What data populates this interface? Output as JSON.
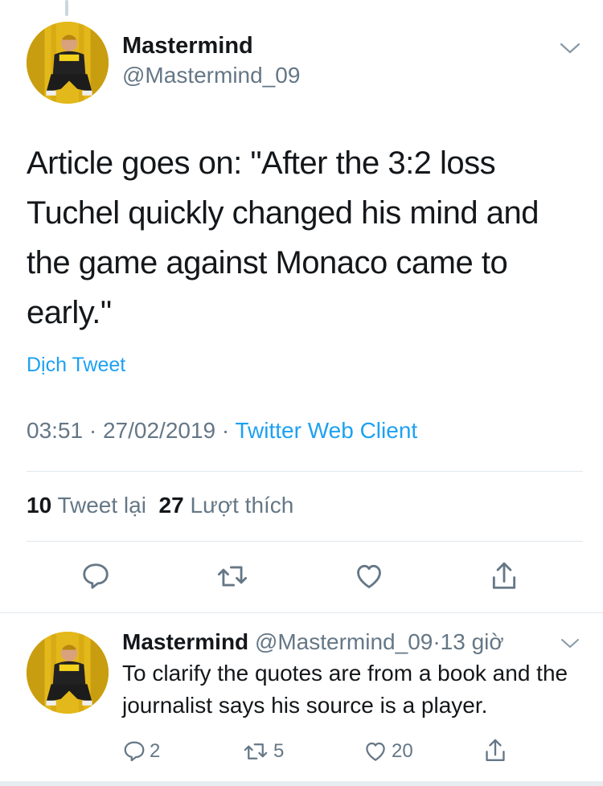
{
  "main_tweet": {
    "display_name": "Mastermind",
    "handle": "@Mastermind_09",
    "text": "Article goes on: \"After the 3:2 loss Tuchel quickly changed his mind and the game against Monaco came to early.\"",
    "translate_label": "Dịch Tweet",
    "time": "03:51",
    "date": "27/02/2019",
    "separator": "·",
    "client": "Twitter Web Client",
    "retweet_count": "10",
    "retweet_label": "Tweet lại",
    "like_count": "27",
    "like_label": "Lượt thích"
  },
  "reply_tweet": {
    "display_name": "Mastermind",
    "handle": "@Mastermind_09",
    "separator": "·",
    "age": "13 giờ",
    "text": "To clarify the quotes are from a book and the journalist says his source is a player.",
    "reply_count": "2",
    "retweet_count": "5",
    "like_count": "20"
  },
  "icons": [
    "chevron-down-icon",
    "reply-icon",
    "retweet-icon",
    "like-icon",
    "share-icon"
  ],
  "colors": {
    "link": "#1da1f2",
    "secondary": "#657786",
    "divider": "#e1e8ed",
    "text": "#14171a"
  }
}
